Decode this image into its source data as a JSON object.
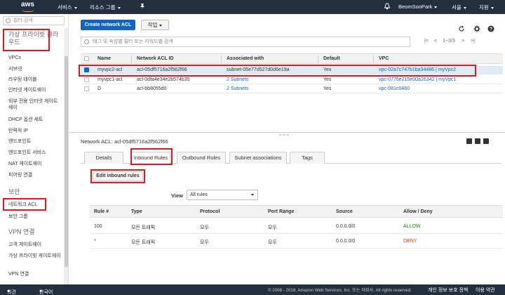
{
  "topnav": {
    "logo": "aws",
    "services": "서비스",
    "resource_groups": "리소스 그룹",
    "user": "BeomSooPark",
    "region": "서울",
    "support": "지원"
  },
  "sidebar": {
    "search_placeholder": "필터 검색",
    "section_vpc": "가상 프라이빗 클라우드",
    "items_vpc": [
      "VPCs",
      "서브넷",
      "라우팅 테이블",
      "인터넷 게이트웨이",
      "외부 전용 인터넷 게이트웨이",
      "DHCP 옵션 세트",
      "탄력적 IP",
      "엔드포인트",
      "엔드포인트 서비스",
      "NAT 게이트웨이",
      "피어링 연결"
    ],
    "section_security": "보안",
    "items_security": [
      "네트워크 ACL",
      "보안 그룹"
    ],
    "section_vpn": "VPN 연결",
    "items_vpn": [
      "고객 게이트웨이",
      "가상 프라이빗 게이트웨이",
      "VPN 연결"
    ]
  },
  "toolbar": {
    "create_label": "Create network ACL",
    "action_label": "작업"
  },
  "filter": {
    "placeholder": "태그 및 속성별 필터 또는 키워드별 검색"
  },
  "pager": {
    "range": "1~3/3"
  },
  "acl_table": {
    "headers": [
      "Name",
      "Network ACL ID",
      "Associated with",
      "Default",
      "VPC"
    ],
    "rows": [
      {
        "name": "myvpc2-acl",
        "id": "acl-05df5716a2f562f66",
        "assoc": "subnet-05e77d527d0d6e19a",
        "default": "Yes",
        "vpc": "vpc-02a7c747b1ba34486 | myVpc2",
        "selected": true
      },
      {
        "name": "myvpc1-acl",
        "id": "acl-0dfa4e34e2b574b35",
        "assoc": "2 Subnets",
        "default": "Yes",
        "vpc": "vpc-0776e215e00a26342 | myVpc1",
        "selected": false
      },
      {
        "name": "D",
        "id": "acl-bb8055d0",
        "assoc": "2 Subnets",
        "default": "Yes",
        "vpc": "vpc-081c0460",
        "selected": false
      }
    ]
  },
  "detail": {
    "title_label": "Network ACL:",
    "title_value": "acl-05df5716a2f562f66",
    "tabs": [
      "Details",
      "Inbound Rules",
      "Outbound Rules",
      "Subnet associations",
      "Tags"
    ],
    "edit_label": "Edit inbound rules",
    "view_label": "View",
    "view_selected": "All rules"
  },
  "rules_table": {
    "headers": [
      "Rule #",
      "Type",
      "Protocol",
      "Port Range",
      "Source",
      "Allow / Deny"
    ],
    "rows": [
      {
        "rule": "100",
        "type": "모든 트래픽",
        "protocol": "모두",
        "port": "모두",
        "source": "0.0.0.0/0",
        "action": "ALLOW"
      },
      {
        "rule": "*",
        "type": "모든 트래픽",
        "protocol": "모두",
        "port": "모두",
        "source": "0.0.0.0/0",
        "action": "DENY"
      }
    ]
  },
  "footer": {
    "feedback": "의견",
    "language": "한국어",
    "copyright": "© 2008 - 2018, Amazon Web Services, Inc. 또는 자회사. All rights reserved.",
    "privacy": "개인 정보 보호 정책",
    "terms": "이용 약관"
  }
}
